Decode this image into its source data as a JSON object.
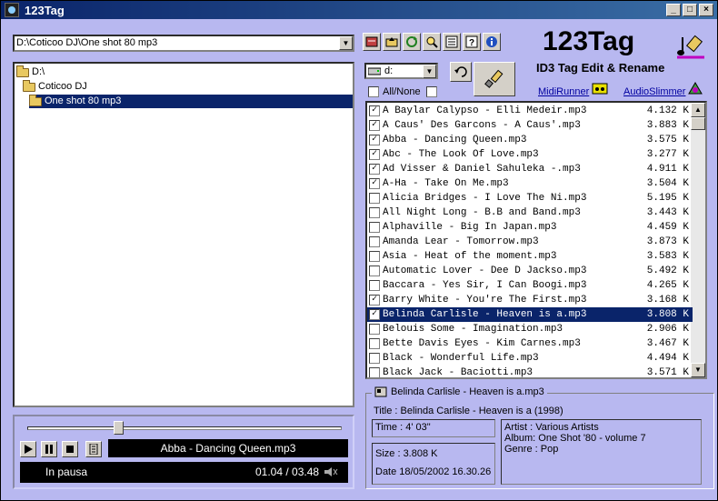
{
  "window": {
    "title": "123Tag",
    "min": "_",
    "max": "□",
    "close": "×"
  },
  "path": {
    "value": "D:\\Coticoo DJ\\One shot 80 mp3"
  },
  "tree": [
    {
      "label": "D:\\",
      "indent": 0,
      "selected": false
    },
    {
      "label": "Coticoo DJ",
      "indent": 1,
      "selected": false
    },
    {
      "label": "One shot 80 mp3",
      "indent": 2,
      "selected": true
    }
  ],
  "player": {
    "now_playing": "Abba - Dancing Queen.mp3",
    "status": "In pausa",
    "time": "01.04 / 03.48",
    "position": 0.28
  },
  "app": {
    "name": "123Tag",
    "subtitle": "ID3 Tag Edit & Rename"
  },
  "drive": {
    "value": "d:"
  },
  "allnone": {
    "label": "All/None"
  },
  "links": {
    "midirunner": "MidiRunner",
    "audioslimmer": "AudioSlimmer"
  },
  "files": [
    {
      "name": "A Baylar Calypso - Elli Medeir.mp3",
      "size": "4.132 K",
      "checked": true,
      "selected": false
    },
    {
      "name": "A Caus' Des Garcons - A Caus'.mp3",
      "size": "3.883 K",
      "checked": true,
      "selected": false
    },
    {
      "name": "Abba - Dancing Queen.mp3",
      "size": "3.575 K",
      "checked": true,
      "selected": false
    },
    {
      "name": "Abc - The Look Of Love.mp3",
      "size": "3.277 K",
      "checked": true,
      "selected": false
    },
    {
      "name": "Ad Visser & Daniel Sahuleka -.mp3",
      "size": "4.911 K",
      "checked": true,
      "selected": false
    },
    {
      "name": "A-Ha - Take On Me.mp3",
      "size": "3.504 K",
      "checked": true,
      "selected": false
    },
    {
      "name": "Alicia Bridges - I Love The Ni.mp3",
      "size": "5.195 K",
      "checked": false,
      "selected": false
    },
    {
      "name": "All Night Long - B.B and Band.mp3",
      "size": "3.443 K",
      "checked": false,
      "selected": false
    },
    {
      "name": "Alphaville - Big In Japan.mp3",
      "size": "4.459 K",
      "checked": false,
      "selected": false
    },
    {
      "name": "Amanda Lear - Tomorrow.mp3",
      "size": "3.873 K",
      "checked": false,
      "selected": false
    },
    {
      "name": "Asia - Heat of the moment.mp3",
      "size": "3.583 K",
      "checked": false,
      "selected": false
    },
    {
      "name": "Automatic Lover - Dee D Jackso.mp3",
      "size": "5.492 K",
      "checked": false,
      "selected": false
    },
    {
      "name": "Baccara - Yes Sir, I Can Boogi.mp3",
      "size": "4.265 K",
      "checked": false,
      "selected": false
    },
    {
      "name": "Barry White - You're The First.mp3",
      "size": "3.168 K",
      "checked": true,
      "selected": false
    },
    {
      "name": "Belinda Carlisle - Heaven is a.mp3",
      "size": "3.808 K",
      "checked": true,
      "selected": true
    },
    {
      "name": "Belouis Some - Imagination.mp3",
      "size": "2.906 K",
      "checked": false,
      "selected": false
    },
    {
      "name": "Bette Davis Eyes - Kim Carnes.mp3",
      "size": "3.467 K",
      "checked": false,
      "selected": false
    },
    {
      "name": "Black - Wonderful Life.mp3",
      "size": "4.494 K",
      "checked": false,
      "selected": false
    },
    {
      "name": "Black Jack - Baciotti.mp3",
      "size": "3.571 K",
      "checked": false,
      "selected": false
    }
  ],
  "info": {
    "filename": "Belinda Carlisle - Heaven is a.mp3",
    "title": "Title : Belinda Carlisle - Heaven is a  (1998)",
    "time": "Time : 4' 03\"",
    "size": "Size : 3.808 K",
    "date": "Date 18/05/2002 16.30.26",
    "artist": "Artist : Various Artists",
    "album": "Album: One Shot '80 - volume 7",
    "genre": "Genre : Pop"
  }
}
